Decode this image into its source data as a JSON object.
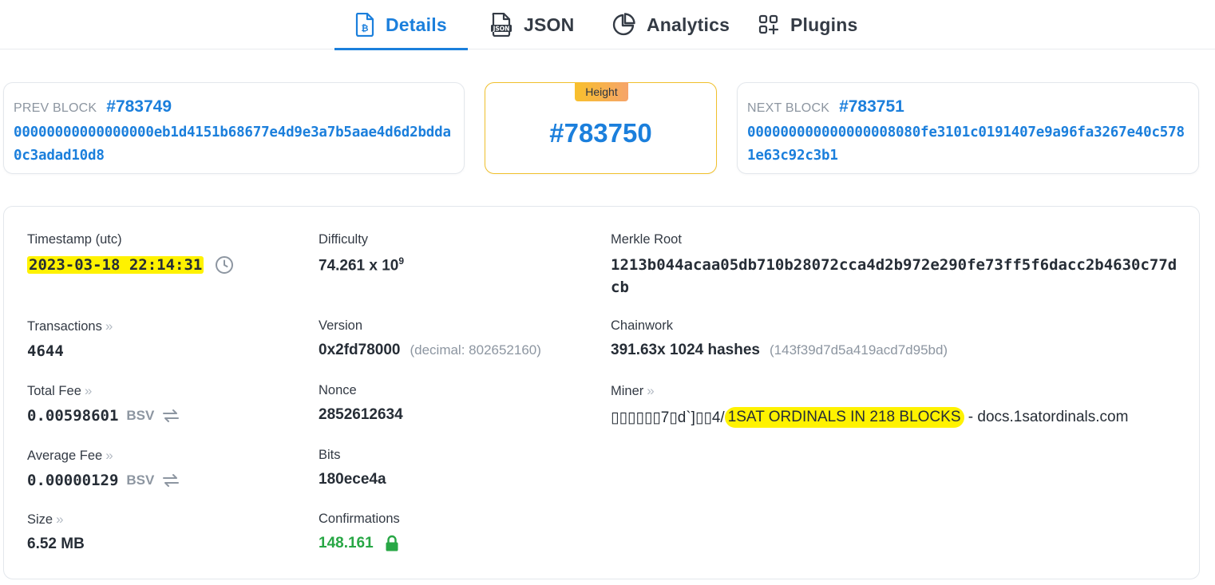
{
  "tabs": {
    "details": "Details",
    "json": "JSON",
    "analytics": "Analytics",
    "plugins": "Plugins"
  },
  "prev_block": {
    "caption": "PREV BLOCK",
    "number": "#783749",
    "hash": "00000000000000000eb1d4151b68677e4d9e3a7b5aae4d6d2bdda0c3adad10d8"
  },
  "height": {
    "badge": "Height",
    "value": "#783750"
  },
  "next_block": {
    "caption": "NEXT BLOCK",
    "number": "#783751",
    "hash": "000000000000000008080fe3101c0191407e9a96fa3267e40c5781e63c92c3b1"
  },
  "details": {
    "timestamp": {
      "label": "Timestamp (utc)",
      "value": "2023-03-18 22:14:31"
    },
    "difficulty": {
      "label": "Difficulty",
      "value": "74.261 x 10",
      "exponent": "9"
    },
    "merkle_root": {
      "label": "Merkle Root",
      "value": "1213b044acaa05db710b28072cca4d2b972e290fe73ff5f6dacc2b4630c77dcb"
    },
    "transactions": {
      "label": "Transactions",
      "value": "4644"
    },
    "version": {
      "label": "Version",
      "value": "0x2fd78000",
      "decimal": "(decimal: 802652160)"
    },
    "chainwork": {
      "label": "Chainwork",
      "value": "391.63x 1024 hashes",
      "raw": "(143f39d7d5a419acd7d95bd)"
    },
    "total_fee": {
      "label": "Total Fee",
      "value": "0.00598601",
      "unit": "BSV"
    },
    "nonce": {
      "label": "Nonce",
      "value": "2852612634"
    },
    "miner": {
      "label": "Miner",
      "prefix": "▯▯▯▯▯▯7▯d`]▯▯4/",
      "highlight": "1SAT ORDINALS IN 218 BLOCKS",
      "suffix": " - docs.1satordinals.com"
    },
    "average_fee": {
      "label": "Average Fee",
      "value": "0.00000129",
      "unit": "BSV"
    },
    "bits": {
      "label": "Bits",
      "value": "180ece4a"
    },
    "size": {
      "label": "Size",
      "value": "6.52 MB"
    },
    "confirmations": {
      "label": "Confirmations",
      "value": "148.161"
    }
  },
  "colors": {
    "accent": "#1b7fdc",
    "highlight": "#fff200",
    "height_border": "#f0c02c",
    "confirm_green": "#28a745"
  }
}
